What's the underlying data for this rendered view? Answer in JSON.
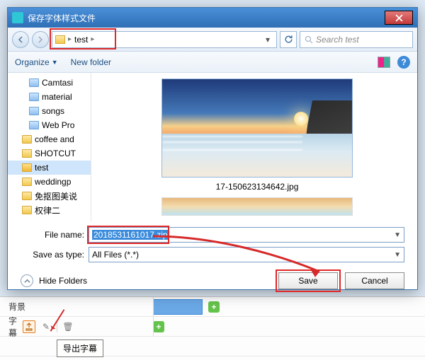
{
  "window": {
    "title": "保存字体样式文件"
  },
  "nav": {
    "crumb_folder_icon": "folder",
    "crumb1": "test",
    "search_placeholder": "Search test"
  },
  "toolbar": {
    "organize": "Organize",
    "new_folder": "New folder"
  },
  "tree": {
    "items": [
      {
        "label": "Camtasi"
      },
      {
        "label": "material"
      },
      {
        "label": "songs"
      },
      {
        "label": "Web Pro"
      },
      {
        "label": "coffee and"
      },
      {
        "label": "SHOTCUT"
      },
      {
        "label": "test",
        "selected": true
      },
      {
        "label": "weddingp"
      },
      {
        "label": "免抠图美说"
      },
      {
        "label": "权律二"
      }
    ]
  },
  "content": {
    "image_caption": "17-150623134642.jpg"
  },
  "fields": {
    "filename_label": "File name:",
    "filename_value": "2018531161017.zip",
    "type_label": "Save as type:",
    "type_value": "All Files (*.*)"
  },
  "bottom": {
    "hide_folders": "Hide Folders",
    "save": "Save",
    "cancel": "Cancel"
  },
  "bg": {
    "track1": "背景",
    "track2": "字幕",
    "tooltip": "导出字幕"
  }
}
